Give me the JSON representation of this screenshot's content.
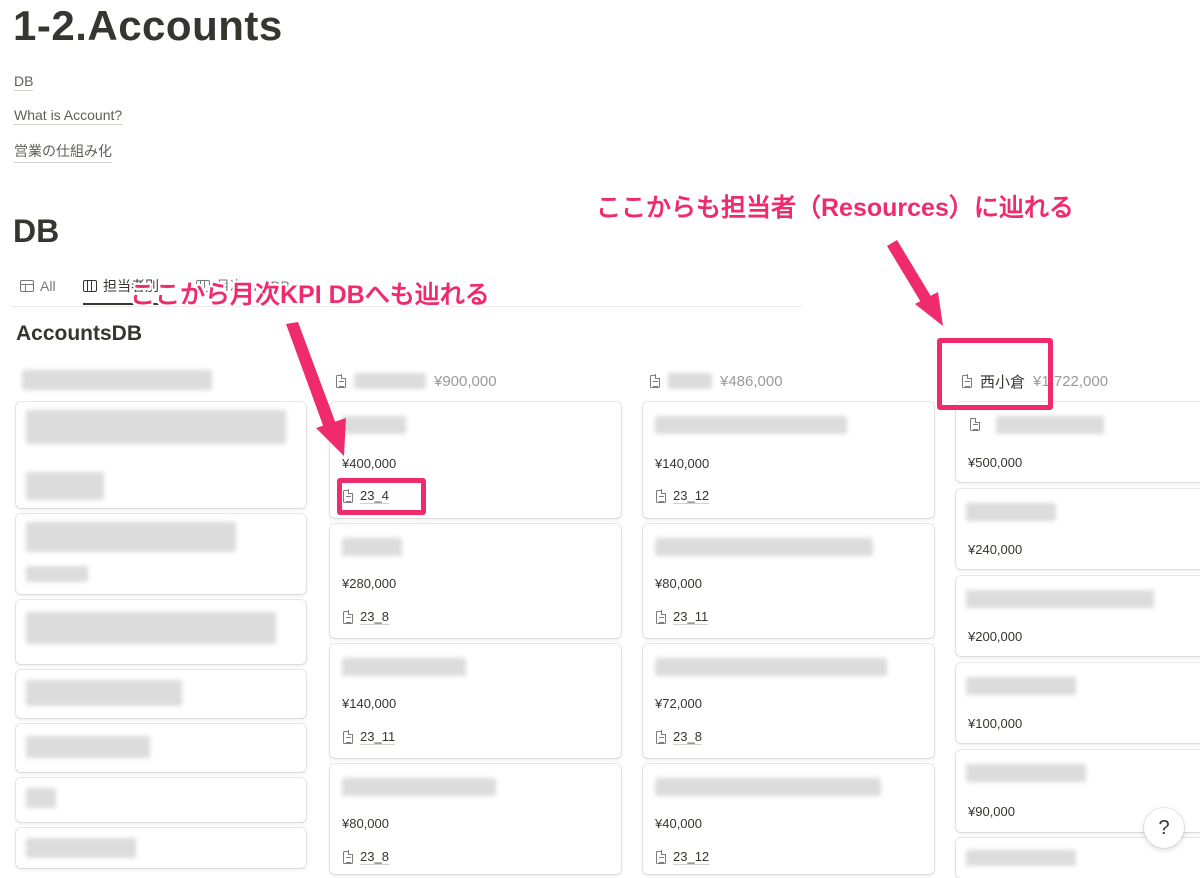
{
  "page": {
    "title": "1-2.Accounts"
  },
  "toc": [
    "DB",
    "What is Account?",
    "営業の仕組み化"
  ],
  "section": {
    "title": "DB"
  },
  "tabs": [
    {
      "label": "All",
      "icon": "table-icon",
      "active": false
    },
    {
      "label": "担当者別",
      "icon": "board-icon",
      "active": true
    },
    {
      "label": "月次KPI DB",
      "icon": "board-icon",
      "active": false
    }
  ],
  "database": {
    "title": "AccountsDB"
  },
  "columns": [
    {
      "name": "",
      "total": "¥900,000",
      "cards": [
        {
          "amount": "¥400,000",
          "kpi": "23_4"
        },
        {
          "amount": "¥280,000",
          "kpi": "23_8"
        },
        {
          "amount": "¥140,000",
          "kpi": "23_11"
        },
        {
          "amount": "¥80,000",
          "kpi": "23_8"
        }
      ]
    },
    {
      "name": "",
      "total": "¥486,000",
      "cards": [
        {
          "amount": "¥140,000",
          "kpi": "23_12"
        },
        {
          "amount": "¥80,000",
          "kpi": "23_11"
        },
        {
          "amount": "¥72,000",
          "kpi": "23_8"
        },
        {
          "amount": "¥40,000",
          "kpi": "23_12"
        }
      ]
    },
    {
      "name": "西小倉",
      "total": "¥1,722,000",
      "cards": [
        {
          "amount": "¥500,000"
        },
        {
          "amount": "¥240,000"
        },
        {
          "amount": "¥200,000"
        },
        {
          "amount": "¥100,000"
        },
        {
          "amount": "¥90,000"
        }
      ]
    }
  ],
  "annotations": {
    "resources": "ここからも担当者（Resources）に辿れる",
    "kpi": "ここから月次KPI DBへも辿れる"
  },
  "help": {
    "label": "?"
  },
  "colors": {
    "annotation": "#ef2b6e",
    "text": "#37352f",
    "muted": "#9b9a97"
  }
}
